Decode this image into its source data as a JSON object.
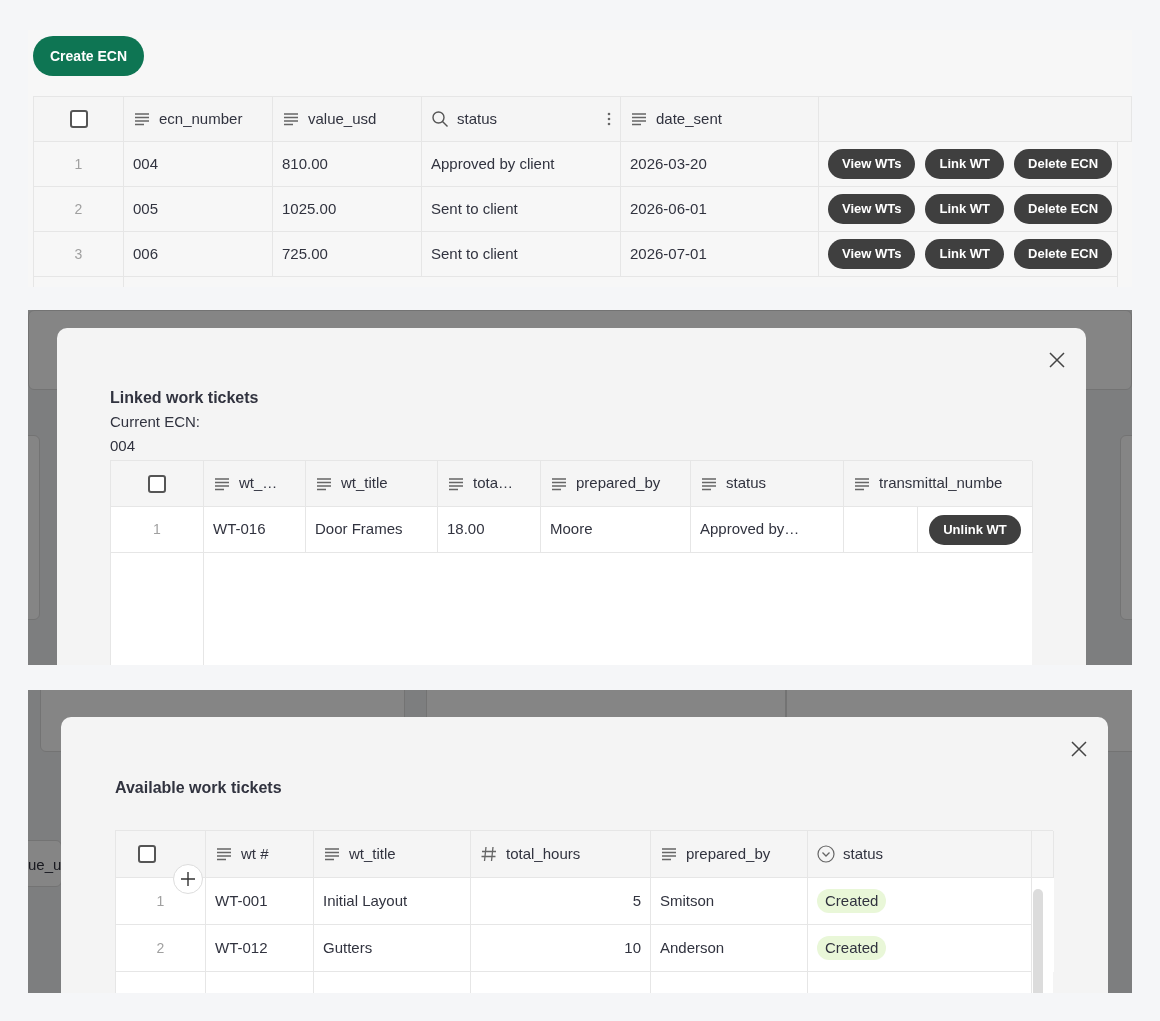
{
  "ecn_list": {
    "create_button": "Create ECN",
    "select_all": {
      "checked": false
    },
    "columns": [
      {
        "label": "ecn_number",
        "kind": "text",
        "menu": false
      },
      {
        "label": "value_usd",
        "kind": "text",
        "menu": false
      },
      {
        "label": "status",
        "kind": "search",
        "menu": true
      },
      {
        "label": "date_sent",
        "kind": "text",
        "menu": false
      }
    ],
    "rows": [
      {
        "index": "1",
        "cells": [
          "004",
          "810.00",
          "Approved by client",
          "2026-03-20"
        ],
        "actions": [
          "View WTs",
          "Link WT",
          "Delete ECN"
        ]
      },
      {
        "index": "2",
        "cells": [
          "005",
          "1025.00",
          "Sent to client",
          "2026-06-01"
        ],
        "actions": [
          "View WTs",
          "Link WT",
          "Delete ECN"
        ]
      },
      {
        "index": "3",
        "cells": [
          "006",
          "725.00",
          "Sent to client",
          "2026-07-01"
        ],
        "actions": [
          "View WTs",
          "Link WT",
          "Delete ECN"
        ]
      }
    ]
  },
  "linked_dialog": {
    "title": "Linked work tickets",
    "subtitle": "Current ECN:",
    "ecn": "004",
    "select_all": {
      "checked": false
    },
    "columns": [
      {
        "label": "wt_…",
        "kind": "text"
      },
      {
        "label": "wt_title",
        "kind": "text"
      },
      {
        "label": "tota…",
        "kind": "text"
      },
      {
        "label": "prepared_by",
        "kind": "text"
      },
      {
        "label": "status",
        "kind": "text"
      },
      {
        "label": "transmittal_numbe",
        "kind": "text"
      }
    ],
    "rows": [
      {
        "index": "1",
        "cells": [
          "WT-016",
          "Door Frames",
          "18.00",
          "Moore",
          "Approved by…"
        ],
        "action": "Unlink WT"
      }
    ]
  },
  "available_dialog": {
    "background_text": "ue_u",
    "title": "Available work tickets",
    "select_all": {
      "checked": false
    },
    "columns": [
      {
        "label": "wt #",
        "kind": "text"
      },
      {
        "label": "wt_title",
        "kind": "text"
      },
      {
        "label": "total_hours",
        "kind": "number"
      },
      {
        "label": "prepared_by",
        "kind": "text"
      },
      {
        "label": "status",
        "kind": "select"
      }
    ],
    "rows": [
      {
        "index": "1",
        "wt": "WT-001",
        "title": "Initial Layout",
        "hours": "5",
        "prepared_by": "Smitson",
        "status": {
          "label": "Created",
          "color": "#e9f7d8"
        }
      },
      {
        "index": "2",
        "wt": "WT-012",
        "title": "Gutters",
        "hours": "10",
        "prepared_by": "Anderson",
        "status": {
          "label": "Created",
          "color": "#e9f7d8"
        }
      }
    ]
  }
}
